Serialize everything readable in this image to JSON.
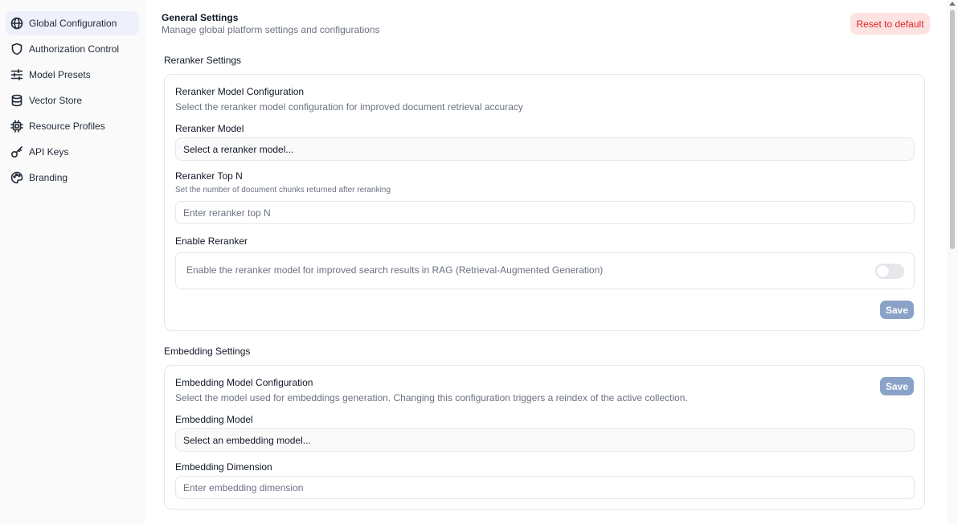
{
  "sidebar": {
    "items": [
      {
        "label": "Global Configuration",
        "icon": "globe-icon",
        "active": true
      },
      {
        "label": "Authorization Control",
        "icon": "shield-icon"
      },
      {
        "label": "Model Presets",
        "icon": "sliders-icon"
      },
      {
        "label": "Vector Store",
        "icon": "database-icon"
      },
      {
        "label": "Resource Profiles",
        "icon": "cpu-icon"
      },
      {
        "label": "API Keys",
        "icon": "key-icon"
      },
      {
        "label": "Branding",
        "icon": "palette-icon"
      }
    ]
  },
  "header": {
    "title": "General Settings",
    "subtitle": "Manage global platform settings and configurations",
    "reset_label": "Reset to default"
  },
  "reranker": {
    "section_title": "Reranker Settings",
    "card_title": "Reranker Model Configuration",
    "card_desc": "Select the reranker model configuration for improved document retrieval accuracy",
    "model_label": "Reranker Model",
    "model_value": "Select a reranker model...",
    "topn_label": "Reranker Top N",
    "topn_help": "Set the number of document chunks returned after reranking",
    "topn_placeholder": "Enter reranker top N",
    "enable_label": "Enable Reranker",
    "enable_desc": "Enable the reranker model for improved search results in RAG (Retrieval-Augmented Generation)",
    "enabled": false,
    "save_label": "Save"
  },
  "embedding": {
    "section_title": "Embedding Settings",
    "card_title": "Embedding Model Configuration",
    "card_desc": "Select the model used for embeddings generation. Changing this configuration triggers a reindex of the active collection.",
    "save_label": "Save",
    "model_label": "Embedding Model",
    "model_value": "Select an embedding model...",
    "dimension_label": "Embedding Dimension",
    "dimension_placeholder": "Enter embedding dimension"
  },
  "colors": {
    "accent_active_bg": "#eef0fb",
    "reset_bg": "#fde2e2",
    "reset_text": "#dc2626",
    "save_bg": "#8aa2c8"
  }
}
